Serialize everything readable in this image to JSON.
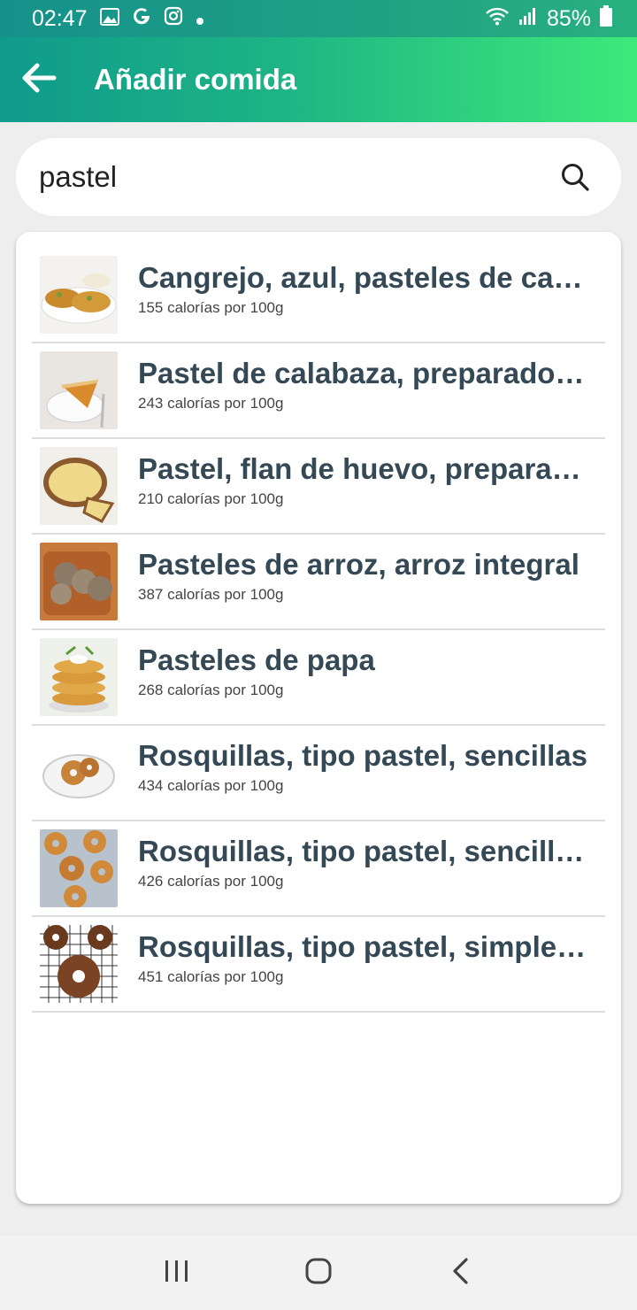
{
  "status_bar": {
    "time": "02:47",
    "battery": "85%",
    "icons_left": [
      "image-icon",
      "google-icon",
      "instagram-icon",
      "dot-icon"
    ],
    "icons_right": [
      "wifi-icon",
      "signal-icon",
      "battery-icon"
    ]
  },
  "app_bar": {
    "title": "Añadir comida",
    "back_icon": "arrow-left-icon"
  },
  "search": {
    "value": "pastel",
    "placeholder": ""
  },
  "results": [
    {
      "name": "Cangrejo, azul, pasteles de cangrejo",
      "calories": "155 calorías por 100g",
      "thumb": "crab-cakes"
    },
    {
      "name": "Pastel de calabaza, preparado comercialmente",
      "calories": "243 calorías por 100g",
      "thumb": "pumpkin-pie"
    },
    {
      "name": "Pastel, flan de huevo, preparado comercialmente",
      "calories": "210 calorías por 100g",
      "thumb": "egg-custard-pie"
    },
    {
      "name": "Pasteles de arroz, arroz integral",
      "calories": "387 calorías por 100g",
      "thumb": "rice-cakes"
    },
    {
      "name": "Pasteles de papa",
      "calories": "268 calorías por 100g",
      "thumb": "potato-pancakes"
    },
    {
      "name": "Rosquillas, tipo pastel, sencillas",
      "calories": "434 calorías por 100g",
      "thumb": "plain-donuts"
    },
    {
      "name": "Rosquillas, tipo pastel, sencillas, azucaradas",
      "calories": "426 calorías por 100g",
      "thumb": "sugared-donuts"
    },
    {
      "name": "Rosquillas, tipo pastel, simples, con chocolate",
      "calories": "451 calorías por 100g",
      "thumb": "chocolate-donuts"
    }
  ],
  "nav_bar": {
    "buttons": [
      "recent-apps-icon",
      "home-icon",
      "back-icon"
    ]
  }
}
